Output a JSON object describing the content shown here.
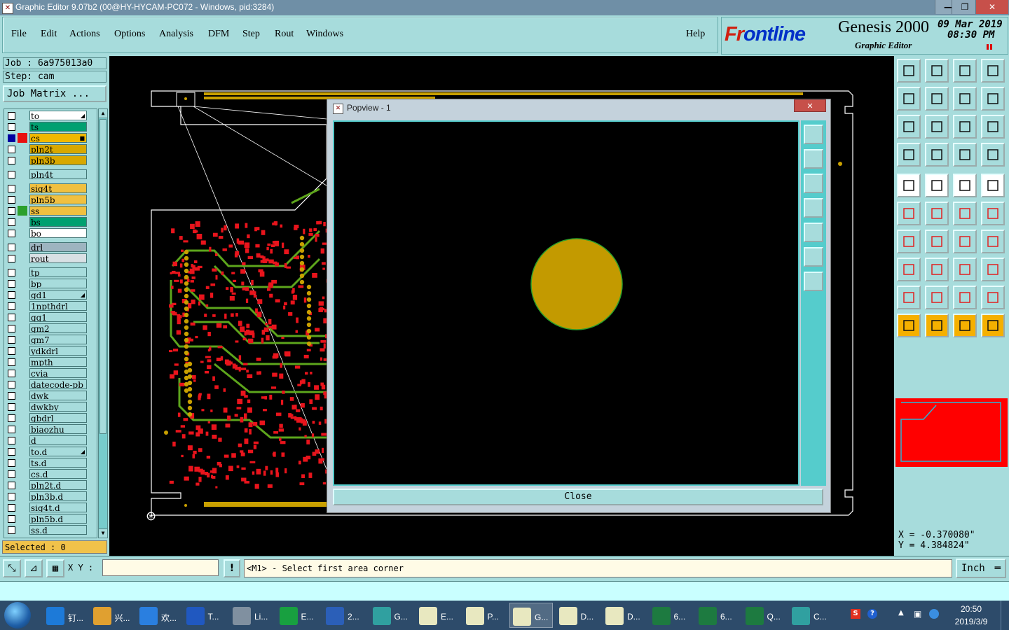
{
  "window": {
    "title": "Graphic Editor 9.07b2 (00@HY-HYCAM-PC072 - Windows, pid:3284)",
    "minimize": "—",
    "maximize": "❐",
    "close": "✕"
  },
  "menu": {
    "file": "File",
    "edit": "Edit",
    "actions": "Actions",
    "options": "Options",
    "analysis": "Analysis",
    "dfm": "DFM",
    "step": "Step",
    "rout": "Rout",
    "windows": "Windows",
    "help": "Help"
  },
  "brand": {
    "logo_prefix": "Fr",
    "logo_rest": "ontline",
    "product": "Genesis 2000",
    "subtitle": "Graphic Editor",
    "date": "09 Mar 2019",
    "time": "08:30 PM"
  },
  "job": {
    "job_label": "Job : 6a975013a0",
    "step_label": "Step: cam",
    "matrix_button": "Job Matrix ..."
  },
  "layers": [
    {
      "name": "to",
      "color": "#ffffff",
      "state": "white",
      "mark": "◢"
    },
    {
      "name": "ts",
      "color": "#00a070",
      "state": "white"
    },
    {
      "name": "cs",
      "color": "#f0b800",
      "state": "active",
      "mark": "■"
    },
    {
      "name": "pln2t",
      "color": "#d8a800",
      "state": "white"
    },
    {
      "name": "pln3b",
      "color": "#d8a800",
      "state": "white"
    },
    {
      "name": "pln4t",
      "color": "#a7dcdc",
      "state": "white"
    },
    {
      "name": "sig4t",
      "color": "#f0c040",
      "state": "white"
    },
    {
      "name": "pln5b",
      "color": "#f0c040",
      "state": "white"
    },
    {
      "name": "ss",
      "color": "#f0c040",
      "state": "green"
    },
    {
      "name": "bs",
      "color": "#00a070",
      "state": "white"
    },
    {
      "name": "bo",
      "color": "#ffffff",
      "state": "white"
    },
    {
      "name": "drl",
      "color": "#9db4c0",
      "state": "white"
    },
    {
      "name": "rout",
      "color": "#d8e0e4",
      "state": "white"
    },
    {
      "name": "tp",
      "color": "#a7dcdc",
      "state": "white"
    },
    {
      "name": "bp",
      "color": "#a7dcdc",
      "state": "white"
    },
    {
      "name": "gd1",
      "color": "#a7dcdc",
      "state": "white",
      "mark": "◢"
    },
    {
      "name": "1npthdrl",
      "color": "#a7dcdc",
      "state": "white"
    },
    {
      "name": "gg1",
      "color": "#a7dcdc",
      "state": "white"
    },
    {
      "name": "gm2",
      "color": "#a7dcdc",
      "state": "white"
    },
    {
      "name": "gm7",
      "color": "#a7dcdc",
      "state": "white"
    },
    {
      "name": "ydkdrl",
      "color": "#a7dcdc",
      "state": "white"
    },
    {
      "name": "mpth",
      "color": "#a7dcdc",
      "state": "white"
    },
    {
      "name": "cvia",
      "color": "#a7dcdc",
      "state": "white"
    },
    {
      "name": "datecode-pb",
      "color": "#a7dcdc",
      "state": "white"
    },
    {
      "name": "dwk",
      "color": "#a7dcdc",
      "state": "white"
    },
    {
      "name": "dwkby",
      "color": "#a7dcdc",
      "state": "white"
    },
    {
      "name": "gbdrl",
      "color": "#a7dcdc",
      "state": "white"
    },
    {
      "name": "biaozhu",
      "color": "#a7dcdc",
      "state": "white"
    },
    {
      "name": "d",
      "color": "#a7dcdc",
      "state": "white"
    },
    {
      "name": "to.d",
      "color": "#a7dcdc",
      "state": "white",
      "mark": "◢"
    },
    {
      "name": "ts.d",
      "color": "#a7dcdc",
      "state": "white"
    },
    {
      "name": "cs.d",
      "color": "#a7dcdc",
      "state": "white"
    },
    {
      "name": "pln2t.d",
      "color": "#a7dcdc",
      "state": "white"
    },
    {
      "name": "pln3b.d",
      "color": "#a7dcdc",
      "state": "white"
    },
    {
      "name": "sig4t.d",
      "color": "#a7dcdc",
      "state": "white"
    },
    {
      "name": "pln5b.d",
      "color": "#a7dcdc",
      "state": "white"
    },
    {
      "name": "ss.d",
      "color": "#a7dcdc",
      "state": "white"
    }
  ],
  "selected": "Selected : 0",
  "popview": {
    "title": "Popview - 1",
    "close_label": "Close",
    "close_x": "✕"
  },
  "coords": {
    "x": "X = -0.370080\"",
    "y": "Y = 4.384824\""
  },
  "command": {
    "xy_label": "X Y :",
    "xy_value": "",
    "bang": "!",
    "prompt": "<M1> - Select first area corner",
    "units": "Inch"
  },
  "taskbar": {
    "tasks": [
      {
        "label": "钉...",
        "color": "#1d7ad8"
      },
      {
        "label": "兴...",
        "color": "#e0a030"
      },
      {
        "label": "欢...",
        "color": "#2a7fe0"
      },
      {
        "label": "T...",
        "color": "#2058c0"
      },
      {
        "label": "Li...",
        "color": "#8090a0"
      },
      {
        "label": "E...",
        "color": "#18a040"
      },
      {
        "label": "2...",
        "color": "#2b5fb8"
      },
      {
        "label": "G...",
        "color": "#30a0a0"
      },
      {
        "label": "E...",
        "color": "#e8e8c0"
      },
      {
        "label": "P...",
        "color": "#e8e8c0"
      },
      {
        "label": "G...",
        "color": "#e8e8c0"
      },
      {
        "label": "D...",
        "color": "#e8e8c0"
      },
      {
        "label": "D...",
        "color": "#e8e8c0"
      },
      {
        "label": "6...",
        "color": "#1d7a40"
      },
      {
        "label": "6...",
        "color": "#1d7a40"
      },
      {
        "label": "Q...",
        "color": "#1d7a40"
      },
      {
        "label": "C...",
        "color": "#30a0a0"
      }
    ],
    "clock_time": "20:50",
    "clock_date": "2019/3/9"
  },
  "colors": {
    "panel": "#a7dcdc",
    "accent": "#f0c24a",
    "pad": "#c39a00",
    "pad_outline": "#2ca02c"
  }
}
